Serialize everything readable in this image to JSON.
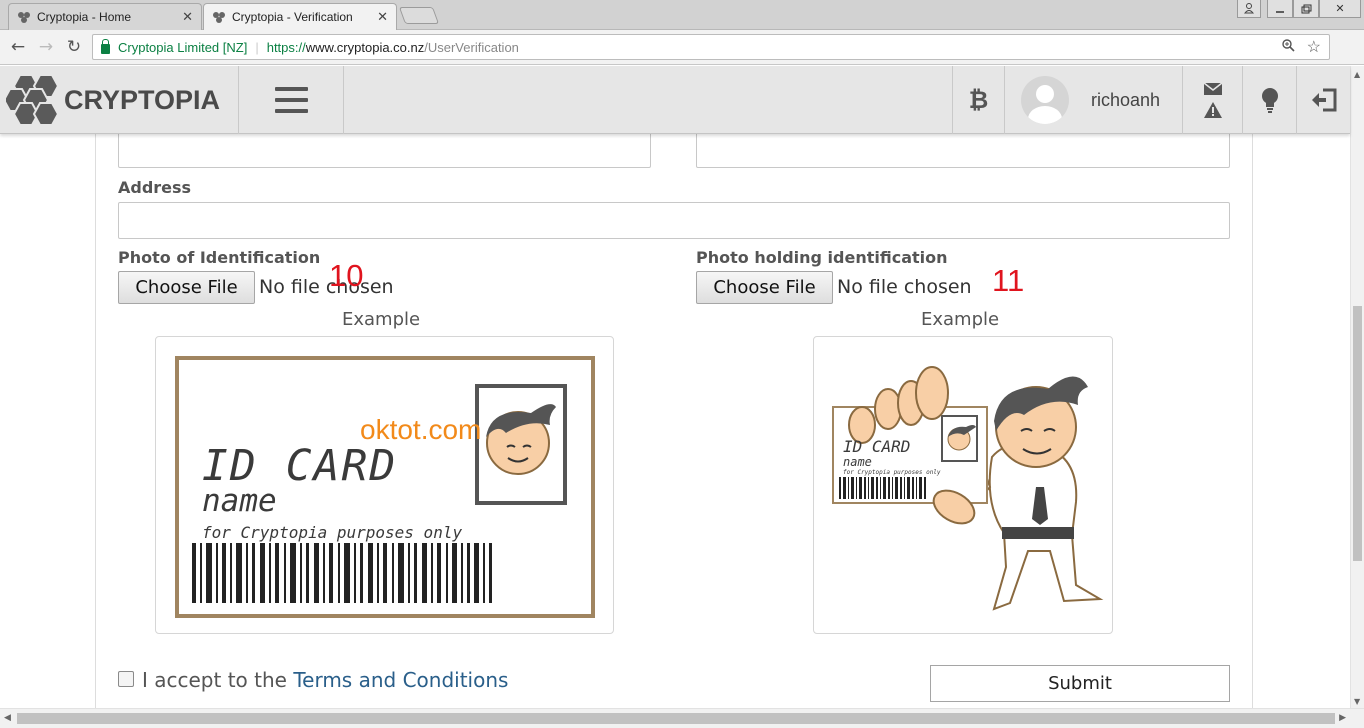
{
  "browser": {
    "tabs": [
      {
        "title": "Cryptopia - Home",
        "active": false
      },
      {
        "title": "Cryptopia - Verification",
        "active": true
      }
    ],
    "site_identity": "Cryptopia Limited [NZ]",
    "url_scheme": "https://",
    "url_host": "www.cryptopia.co.nz",
    "url_path": "/UserVerification",
    "secure_color": "#0b8043"
  },
  "header": {
    "brand": "CRYPTOPIA",
    "username": "richoanh",
    "icons": [
      "hexagon-logo-icon",
      "hamburger-icon",
      "bitcoin-icon",
      "avatar",
      "envelope-icon",
      "warning-icon",
      "lightbulb-icon",
      "logout-icon"
    ]
  },
  "form": {
    "address_label": "Address",
    "photo_id_label": "Photo of Identification",
    "photo_holding_label": "Photo holding identification",
    "choose_file": "Choose File",
    "no_file": "No file chosen",
    "example": "Example",
    "annotation_left": "10",
    "annotation_right": "11",
    "watermark": "oktot.com",
    "accept_text": "I accept to the ",
    "terms_link": "Terms and Conditions",
    "submit": "Submit"
  },
  "id_card": {
    "title": "ID CARD",
    "name": "name",
    "purpose": "for Cryptopia purposes only"
  },
  "colors": {
    "accent_link": "#2a5f8a",
    "annotation_red": "#e0141e",
    "watermark_orange": "#f28a1a",
    "card_border": "#a08560"
  }
}
